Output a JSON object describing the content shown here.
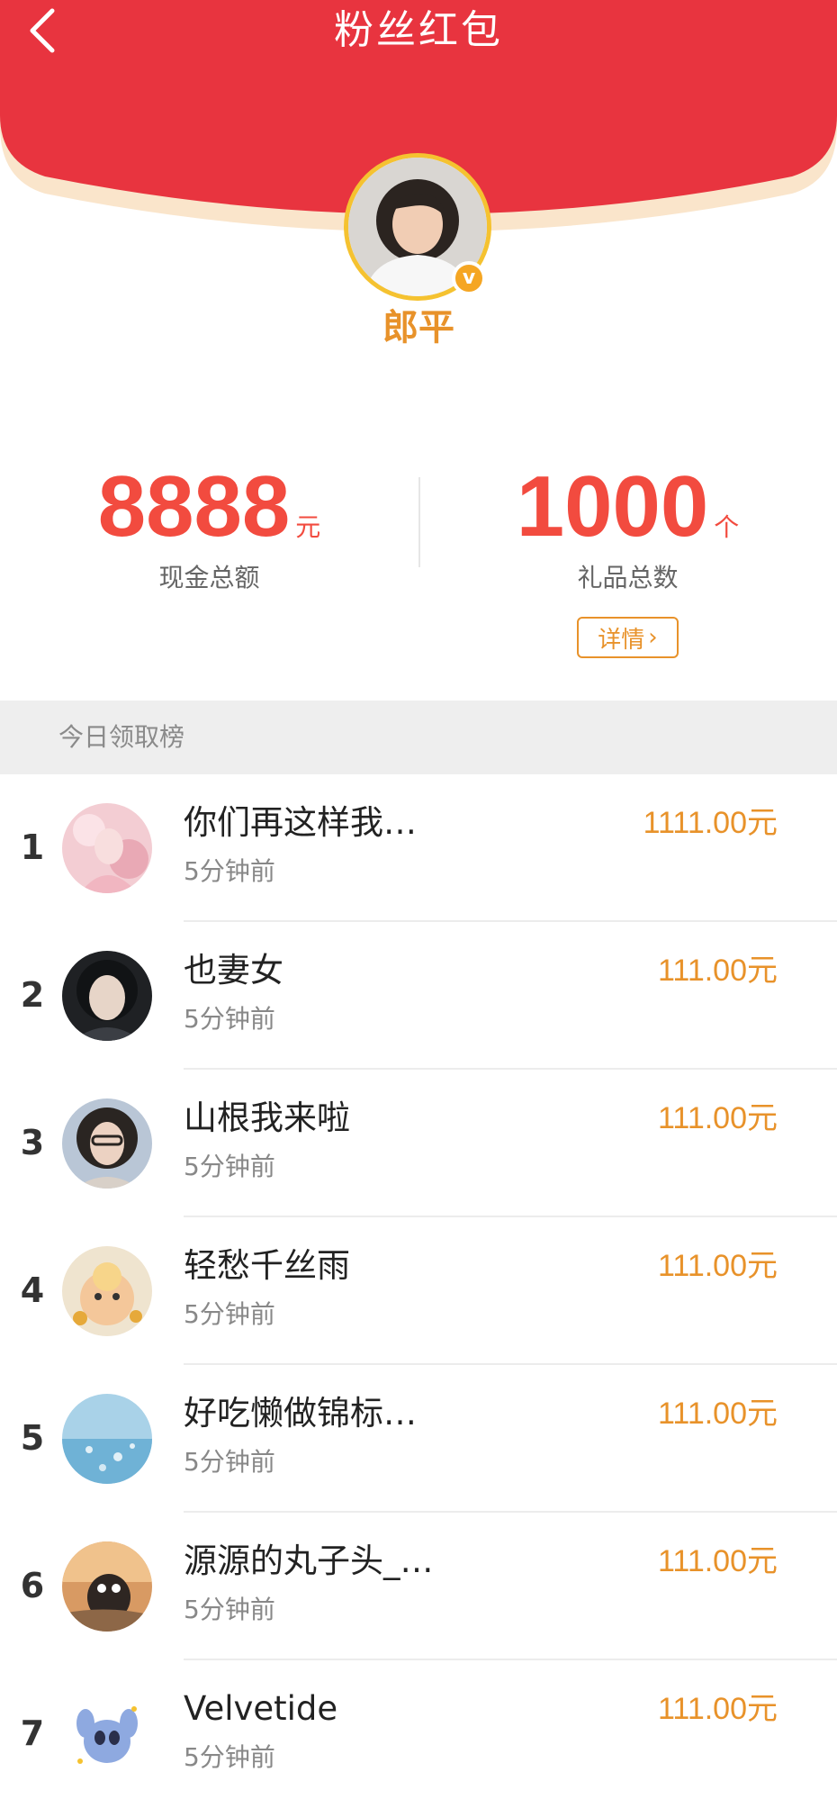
{
  "header": {
    "title": "粉丝红包",
    "back_icon": "chevron-left-icon"
  },
  "profile": {
    "name": "郎平",
    "verified": "v"
  },
  "stats": {
    "cash": {
      "value": "8888",
      "unit": "元",
      "label": "现金总额"
    },
    "gifts": {
      "value": "1000",
      "unit": "个",
      "label": "礼品总数"
    }
  },
  "detail_button": {
    "label": "详情",
    "icon": "chevron-right-icon"
  },
  "section": {
    "title": "今日领取榜"
  },
  "leaderboard": [
    {
      "rank": "1",
      "name": "你们再这样我…",
      "time": "5分钟前",
      "amount": "1111.00元"
    },
    {
      "rank": "2",
      "name": "也妻女",
      "time": "5分钟前",
      "amount": "111.00元"
    },
    {
      "rank": "3",
      "name": "山根我来啦",
      "time": "5分钟前",
      "amount": "111.00元"
    },
    {
      "rank": "4",
      "name": "轻愁千丝雨",
      "time": "5分钟前",
      "amount": "111.00元"
    },
    {
      "rank": "5",
      "name": "好吃懒做锦标…",
      "time": "5分钟前",
      "amount": "111.00元"
    },
    {
      "rank": "6",
      "name": "源源的丸子头_…",
      "time": "5分钟前",
      "amount": "111.00元"
    },
    {
      "rank": "7",
      "name": "Velvetide",
      "time": "5分钟前",
      "amount": "111.00元"
    }
  ],
  "colors": {
    "header_red": "#e8343f",
    "accent_orange": "#e8922a",
    "value_red": "#f24b3f"
  }
}
